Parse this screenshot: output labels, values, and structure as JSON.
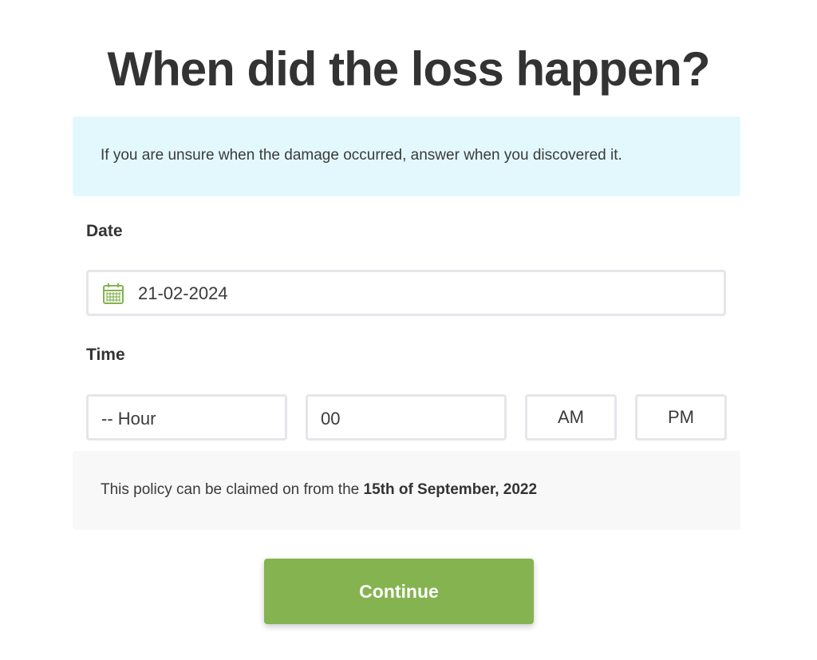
{
  "page": {
    "title": "When did the loss happen?"
  },
  "info": {
    "text": "If you are unsure when the damage occurred, answer when you discovered it."
  },
  "date_field": {
    "label": "Date",
    "value": "21-02-2024",
    "icon": "calendar-icon"
  },
  "time_field": {
    "label": "Time",
    "hour_value": "-- Hour",
    "minute_value": "00",
    "am_label": "AM",
    "pm_label": "PM"
  },
  "policy": {
    "text_prefix": "This policy can be claimed on from the ",
    "date": "15th of September, 2022"
  },
  "continue_label": "Continue",
  "colors": {
    "accent_green": "#84b350",
    "info_background": "#e3f8fd",
    "policy_background": "#f8f8f8",
    "input_border": "#e4e6ea",
    "text_dark": "#333333"
  }
}
